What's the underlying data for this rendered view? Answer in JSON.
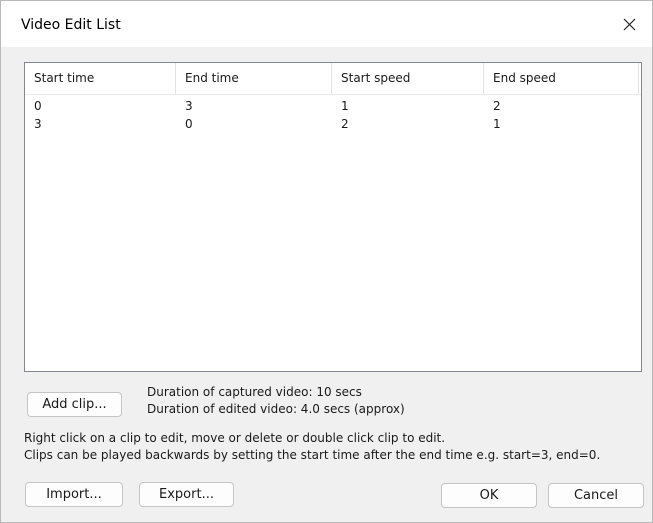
{
  "window": {
    "title": "Video Edit List"
  },
  "icons": {
    "close": "close-icon"
  },
  "clip_list": {
    "columns": [
      "Start time",
      "End time",
      "Start speed",
      "End speed"
    ],
    "rows": [
      [
        "0",
        "3",
        "1",
        "2"
      ],
      [
        "3",
        "0",
        "2",
        "1"
      ]
    ]
  },
  "actions": {
    "add_clip": "Add clip...",
    "import": "Import...",
    "export": "Export...",
    "ok": "OK",
    "cancel": "Cancel"
  },
  "durations": {
    "captured": "Duration of captured video: 10 secs",
    "edited": "Duration of edited video: 4.0 secs (approx)"
  },
  "help": {
    "line1": "Right click on a clip to edit, move or delete or double click clip to edit.",
    "line2": "Clips can be played backwards by setting the start time after the end time e.g. start=3, end=0."
  }
}
